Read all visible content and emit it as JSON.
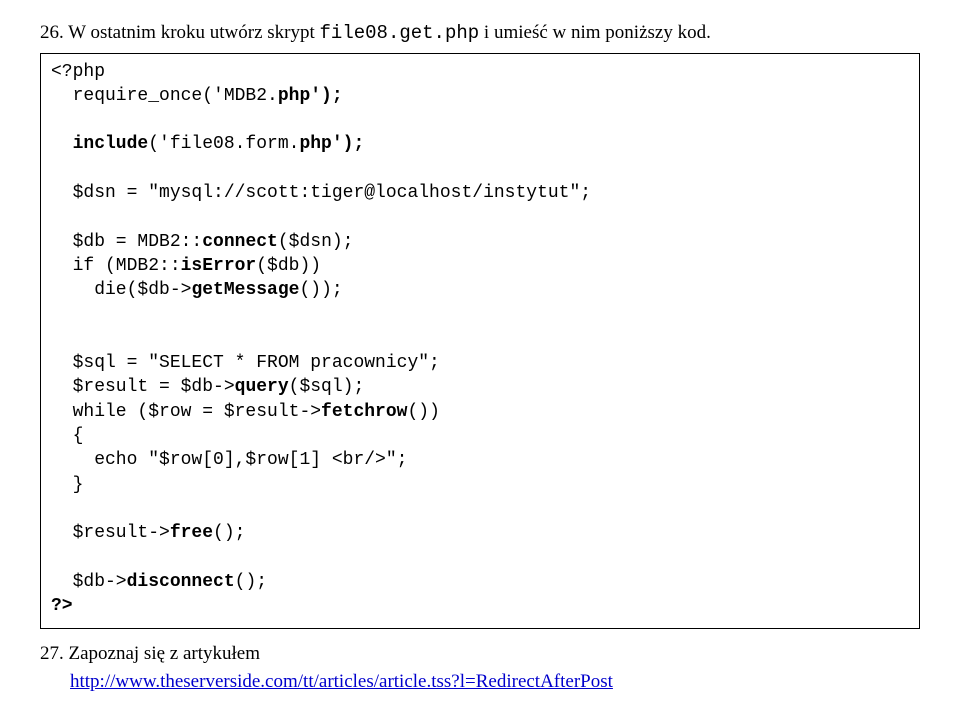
{
  "step26": {
    "prefix": "26. W ostatnim kroku utwórz skrypt ",
    "filename": "file08.get.php",
    "suffix": " i umieść w nim poniższy kod."
  },
  "code": {
    "l1": "<?php",
    "l2a": "  require_once('MDB2.",
    "l2b": "php');",
    "l3": "  ",
    "l4a": "  include",
    "l4b": "('file08.form.",
    "l4c": "php');",
    "l5": "",
    "l6": "  $dsn = \"mysql://scott:tiger@localhost/instytut\";",
    "l7": "",
    "l8a": "  $db = MDB2::",
    "l8b": "connect",
    "l8c": "($dsn);",
    "l9a": "  if (MDB2::",
    "l9b": "isError",
    "l9c": "($db))",
    "l10a": "    die($db->",
    "l10b": "getMessage",
    "l10c": "());",
    "l11": "",
    "l12": "",
    "l13": "  $sql = \"SELECT * FROM pracownicy\";",
    "l14a": "  $result = $db->",
    "l14b": "query",
    "l14c": "($sql);",
    "l15a": "  while ($row = $result->",
    "l15b": "fetchrow",
    "l15c": "())",
    "l16": "  {",
    "l17": "    echo \"$row[0],$row[1] <br/>\";",
    "l18": "  }",
    "l19": "",
    "l20a": "  $result->",
    "l20b": "free",
    "l20c": "();",
    "l21": "",
    "l22a": "  $db->",
    "l22b": "disconnect",
    "l22c": "();",
    "l23": "?>"
  },
  "step27": {
    "text": "27. Zapoznaj się z artykułem",
    "link": "http://www.theserverside.com/tt/articles/article.tss?l=RedirectAfterPost"
  }
}
